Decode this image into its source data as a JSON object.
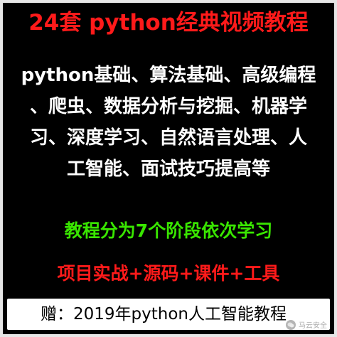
{
  "poster": {
    "title": "24套 python经典视频教程",
    "description_lines": [
      "python基础、算法基础、高级编程",
      "、爬虫、数据分析与挖掘、机器学",
      "习、深度学习、自然语言处理、人",
      "工智能、面试技巧提高等"
    ],
    "stages_line": "教程分为7个阶段依次学习",
    "bundle_line": "项目实战+源码+课件+工具",
    "gift_line": "赠：2019年python人工智能教程",
    "watermark": {
      "text": "马云安全",
      "icon": "wechat-logo-icon"
    }
  },
  "colors": {
    "background": "#000000",
    "title": "#ff1a1a",
    "description": "#ffffff",
    "stages": "#39e600",
    "bundle": "#ff1a1a",
    "gift_bar": "#ffffff",
    "gift_text": "#000000"
  }
}
